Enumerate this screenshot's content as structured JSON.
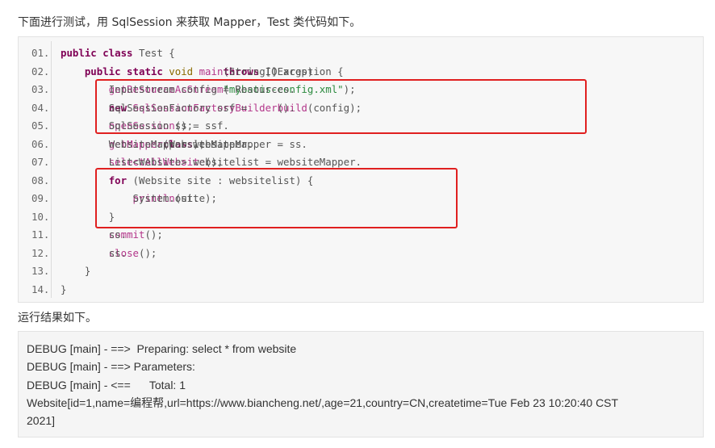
{
  "intro_text": "下面进行测试，用 SqlSession 来获取 Mapper，Test 类代码如下。",
  "code": {
    "lines": [
      {
        "no": "01.",
        "indent": "",
        "tokens": [
          [
            "kw",
            "public class "
          ],
          [
            "src",
            "Test {"
          ]
        ]
      },
      {
        "no": "02.",
        "indent": "    ",
        "tokens": [
          [
            "kw",
            "public static "
          ],
          [
            "ty",
            "void "
          ],
          [
            "fn",
            "main"
          ],
          [
            "src",
            "(String[] args) "
          ],
          [
            "kw",
            "throws "
          ],
          [
            "src",
            "IOException {"
          ]
        ]
      },
      {
        "no": "03.",
        "indent": "        ",
        "tokens": [
          [
            "src",
            "InputStream config = Resources."
          ],
          [
            "fn",
            "getResourceAsStream"
          ],
          [
            "src",
            "("
          ],
          [
            "st",
            "\"mybatis-config.xml\""
          ],
          [
            "src",
            ");"
          ]
        ]
      },
      {
        "no": "04.",
        "indent": "        ",
        "tokens": [
          [
            "src",
            "SqlSessionFactory ssf = "
          ],
          [
            "kw",
            "new "
          ],
          [
            "fn",
            "SqlSessionFactoryBuilder"
          ],
          [
            "src",
            "()."
          ],
          [
            "fn",
            "build"
          ],
          [
            "src",
            "(config);"
          ]
        ]
      },
      {
        "no": "05.",
        "indent": "        ",
        "tokens": [
          [
            "src",
            "SqlSession ss = ssf."
          ],
          [
            "fn",
            "openSession"
          ],
          [
            "src",
            "();"
          ]
        ]
      },
      {
        "no": "06.",
        "indent": "        ",
        "tokens": [
          [
            "src",
            "WebsiteMapper websiteMapper = ss."
          ],
          [
            "fn",
            "getMapper"
          ],
          [
            "src",
            "(WebsiteMapper."
          ],
          [
            "kw",
            "class"
          ],
          [
            "src",
            ");"
          ]
        ]
      },
      {
        "no": "07.",
        "indent": "        ",
        "tokens": [
          [
            "src",
            "List<Website> websitelist = websiteMapper."
          ],
          [
            "fn",
            "selectAllWebsite"
          ],
          [
            "src",
            "();"
          ]
        ]
      },
      {
        "no": "08.",
        "indent": "        ",
        "tokens": [
          [
            "kw",
            "for "
          ],
          [
            "src",
            "(Website site : websitelist) {"
          ]
        ]
      },
      {
        "no": "09.",
        "indent": "            ",
        "tokens": [
          [
            "src",
            "System.out."
          ],
          [
            "fn",
            "println"
          ],
          [
            "src",
            "(site);"
          ]
        ]
      },
      {
        "no": "10.",
        "indent": "        ",
        "tokens": [
          [
            "src",
            "}"
          ]
        ]
      },
      {
        "no": "11.",
        "indent": "        ",
        "tokens": [
          [
            "src",
            "ss."
          ],
          [
            "fn",
            "commit"
          ],
          [
            "src",
            "();"
          ]
        ]
      },
      {
        "no": "12.",
        "indent": "        ",
        "tokens": [
          [
            "src",
            "ss."
          ],
          [
            "fn",
            "close"
          ],
          [
            "src",
            "();"
          ]
        ]
      },
      {
        "no": "13.",
        "indent": "    ",
        "tokens": [
          [
            "src",
            "}"
          ]
        ]
      },
      {
        "no": "14.",
        "indent": "",
        "tokens": [
          [
            "src",
            "}"
          ]
        ]
      }
    ],
    "highlight_color": "#e02020"
  },
  "result_label": "运行结果如下。",
  "output": [
    "DEBUG [main] - ==>  Preparing: select * from website",
    "DEBUG [main] - ==> Parameters: ",
    "DEBUG [main] - <==      Total: 1",
    "Website[id=1,name=编程帮,url=https://www.biancheng.net/,age=21,country=CN,createtime=Tue Feb 23 10:20:40 CST",
    "2021]"
  ]
}
